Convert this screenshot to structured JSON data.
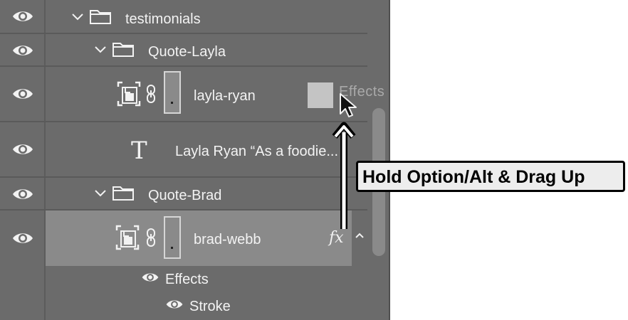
{
  "layers": {
    "testimonials": "testimonials",
    "quote_layla": "Quote-Layla",
    "layla_ryan": "layla-ryan",
    "layla_text": "Layla Ryan “As a foodie...",
    "quote_brad": "Quote-Brad",
    "brad_webb": "brad-webb",
    "effects": "Effects",
    "stroke": "Stroke"
  },
  "drag_ghost": {
    "label": "Effects"
  },
  "callout": {
    "text": "Hold Option/Alt & Drag Up"
  },
  "fx_badge": "fx",
  "type_glyph": "T",
  "icons": [
    "eye-icon",
    "folder-icon",
    "chevron-down-icon",
    "smart-object-icon",
    "link-icon",
    "type-layer-icon",
    "fx-icon",
    "chevron-up-icon",
    "mouse-pointer-icon",
    "arrow-up-icon"
  ],
  "colors": {
    "panel": "#6b6b6b",
    "selected_row": "#8a8a8a",
    "text": "#f3f3f3",
    "callout_bg": "#ededed"
  }
}
